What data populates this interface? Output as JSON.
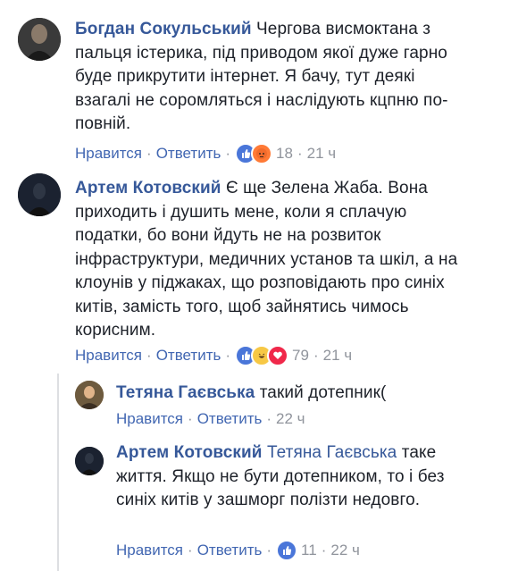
{
  "comments": [
    {
      "author": "Богдан Сокульський",
      "text": "Чергова висмоктана з пальця істерика, під приводом якої дуже гарно буде прикрутити інтернет. Я бачу, тут деякі взагалі не соромляться і наслідують кцпню по-повній.",
      "like_label": "Нравится",
      "reply_label": "Ответить",
      "reactions": [
        "like",
        "angry"
      ],
      "count": "18",
      "time": "21 ч"
    },
    {
      "author": "Артем Котовский",
      "text": "Є ще Зелена Жаба. Вона приходить і душить мене, коли я сплачую податки, бо вони йдуть не на розвиток інфраструктури, медичних установ та шкіл, а на клоунів у піджаках, що розповідають про синіх китів, замість того, щоб зайнятись чимось корисним.",
      "like_label": "Нравится",
      "reply_label": "Ответить",
      "reactions": [
        "like",
        "haha",
        "love"
      ],
      "count": "79",
      "time": "21 ч"
    }
  ],
  "replies": [
    {
      "author": "Тетяна Гаєвська",
      "text": "такий дотепник(",
      "like_label": "Нравится",
      "reply_label": "Ответить",
      "time": "22 ч"
    },
    {
      "author": "Артем Котовский",
      "mention": "Тетяна Гаєвська",
      "text": "таке життя. Якщо не бути дотепником, то і без синіх китів у зашморг полізти недовго.",
      "like_label": "Нравится",
      "reply_label": "Ответить",
      "reactions": [
        "like"
      ],
      "count": "11",
      "time": "22 ч"
    }
  ],
  "colors": {
    "author": "#365899",
    "link": "#4267b2",
    "meta": "#90949c",
    "text": "#1d2129"
  }
}
